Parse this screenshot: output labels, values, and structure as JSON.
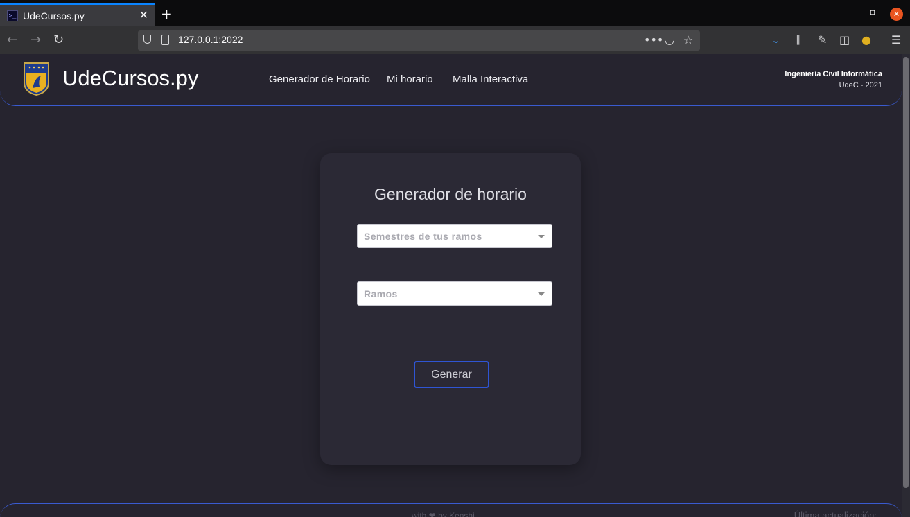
{
  "browser": {
    "tab_title": "UdeCursos.py",
    "url": "127.0.0.1:2022"
  },
  "header": {
    "brand": "UdeCursos.py",
    "nav": [
      {
        "label": "Generador de Horario"
      },
      {
        "label": "Mi horario"
      },
      {
        "label": "Malla Interactiva"
      }
    ],
    "institution_line1": "Ingeniería Civil Informática",
    "institution_line2": "UdeC - 2021"
  },
  "card": {
    "title": "Generador de horario",
    "select_semestres_placeholder": "Semestres de tus ramos",
    "select_ramos_placeholder": "Ramos",
    "generate_label": "Generar"
  },
  "footer": {
    "credit": "with ❤ by Kenshi",
    "update": "Última actualización:"
  },
  "colors": {
    "page_bg": "#26242f",
    "card_bg": "#2b2935",
    "accent": "#2f55d4"
  }
}
